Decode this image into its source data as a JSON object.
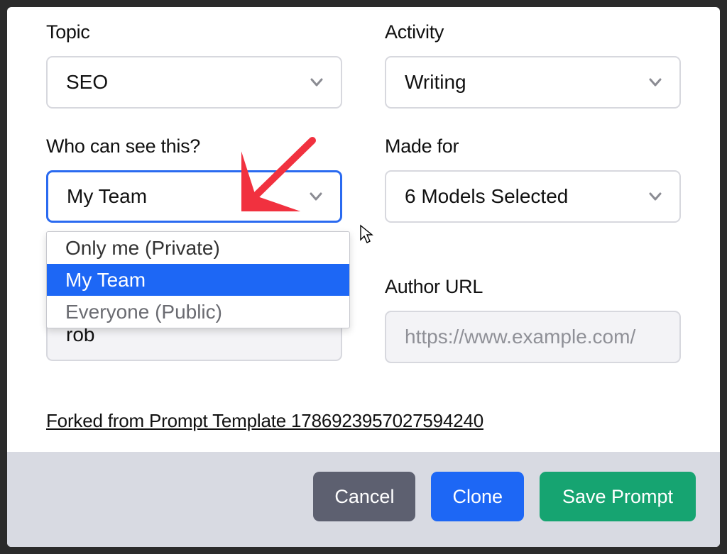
{
  "topic": {
    "label": "Topic",
    "value": "SEO"
  },
  "activity": {
    "label": "Activity",
    "value": "Writing"
  },
  "visibility": {
    "label": "Who can see this?",
    "value": "My Team",
    "options": {
      "0": "Only me (Private)",
      "1": "My Team",
      "2": "Everyone (Public)"
    }
  },
  "made_for": {
    "label": "Made for",
    "value": "6 Models Selected"
  },
  "author_url": {
    "label": "Author URL",
    "placeholder": "https://www.example.com/"
  },
  "author_name": {
    "value": "rob"
  },
  "fork_link": "Forked from Prompt Template 1786923957027594240",
  "buttons": {
    "cancel": "Cancel",
    "clone": "Clone",
    "save": "Save Prompt"
  },
  "annotation": {
    "arrow_color": "#f1313f"
  }
}
